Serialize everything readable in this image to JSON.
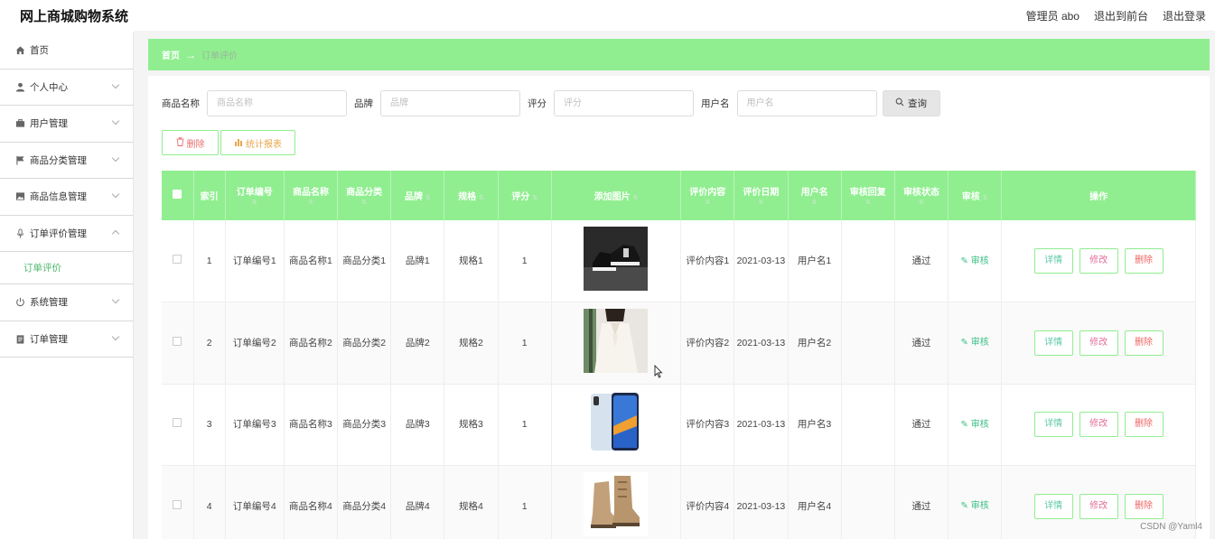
{
  "app": {
    "title": "网上商城购物系统"
  },
  "topbar": {
    "admin": "管理员 abo",
    "back_front": "退出到前台",
    "logout": "退出登录"
  },
  "sidebar": {
    "items": [
      {
        "label": "首页",
        "icon": "home-icon"
      },
      {
        "label": "个人中心",
        "icon": "user-icon"
      },
      {
        "label": "用户管理",
        "icon": "briefcase-icon"
      },
      {
        "label": "商品分类管理",
        "icon": "flag-icon"
      },
      {
        "label": "商品信息管理",
        "icon": "image-icon"
      },
      {
        "label": "订单评价管理",
        "icon": "microphone-icon"
      },
      {
        "label": "系统管理",
        "icon": "power-icon"
      },
      {
        "label": "订单管理",
        "icon": "clipboard-icon"
      }
    ],
    "sub_active": "订单评价"
  },
  "breadcrumb": {
    "home": "首页",
    "current": "订单评价"
  },
  "search": {
    "product_name_label": "商品名称",
    "product_name_placeholder": "商品名称",
    "brand_label": "品牌",
    "brand_placeholder": "品牌",
    "rating_label": "评分",
    "rating_placeholder": "评分",
    "username_label": "用户名",
    "username_placeholder": "用户名",
    "query_label": "查询"
  },
  "actions": {
    "delete_label": "删除",
    "stats_label": "统计报表"
  },
  "table": {
    "headers": [
      "索引",
      "订单编号",
      "商品名称",
      "商品分类",
      "品牌",
      "规格",
      "评分",
      "添加图片",
      "评价内容",
      "评价日期",
      "用户名",
      "审核回复",
      "审核状态",
      "审核",
      "操作"
    ],
    "rows": [
      {
        "index": "1",
        "order_no": "订单编号1",
        "name": "商品名称1",
        "category": "商品分类1",
        "brand": "品牌1",
        "spec": "规格1",
        "rating": "1",
        "image": "sneaker",
        "content": "评价内容1",
        "date": "2021-03-13",
        "user": "用户名1",
        "reply": "",
        "status": "通过",
        "review": "审核"
      },
      {
        "index": "2",
        "order_no": "订单编号2",
        "name": "商品名称2",
        "category": "商品分类2",
        "brand": "品牌2",
        "spec": "规格2",
        "rating": "1",
        "image": "blouse",
        "content": "评价内容2",
        "date": "2021-03-13",
        "user": "用户名2",
        "reply": "",
        "status": "通过",
        "review": "审核"
      },
      {
        "index": "3",
        "order_no": "订单编号3",
        "name": "商品名称3",
        "category": "商品分类3",
        "brand": "品牌3",
        "spec": "规格3",
        "rating": "1",
        "image": "phone",
        "content": "评价内容3",
        "date": "2021-03-13",
        "user": "用户名3",
        "reply": "",
        "status": "通过",
        "review": "审核"
      },
      {
        "index": "4",
        "order_no": "订单编号4",
        "name": "商品名称4",
        "category": "商品分类4",
        "brand": "品牌4",
        "spec": "规格4",
        "rating": "1",
        "image": "boots",
        "content": "评价内容4",
        "date": "2021-03-13",
        "user": "用户名4",
        "reply": "",
        "status": "通过",
        "review": "审核"
      }
    ],
    "row_actions": {
      "detail": "详情",
      "edit": "修改",
      "delete": "删除"
    }
  },
  "watermark": "CSDN @Yaml4",
  "colors": {
    "accent": "#90ee90",
    "link": "#3bbf86"
  }
}
